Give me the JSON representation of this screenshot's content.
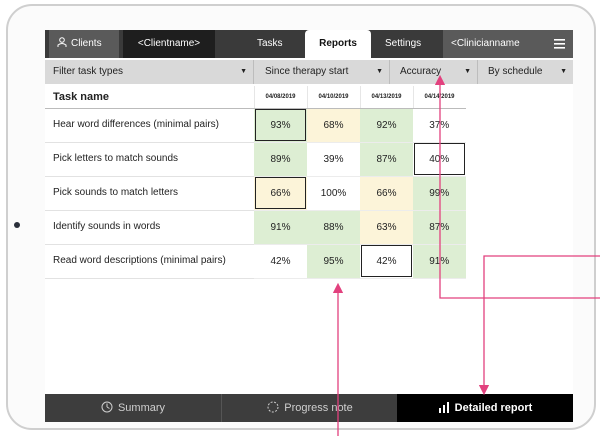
{
  "nav": {
    "clients_label": "Clients",
    "clientname": "<Clientname>",
    "tabs": [
      "Tasks",
      "Reports",
      "Settings"
    ],
    "clinician": "<Clinicianname"
  },
  "filters": {
    "task_types": "Filter task types",
    "since": "Since therapy start",
    "metric": "Accuracy",
    "schedule": "By schedule"
  },
  "table": {
    "name_header": "Task name",
    "dates": [
      "04/08/2019",
      "04/10/2019",
      "04/13/2019",
      "04/14/2019"
    ],
    "rows": [
      {
        "name": "Hear word differences (minimal pairs)",
        "values": [
          "93%",
          "68%",
          "92%",
          "37%"
        ]
      },
      {
        "name": "Pick letters to match sounds",
        "values": [
          "89%",
          "39%",
          "87%",
          "40%"
        ]
      },
      {
        "name": "Pick sounds to match letters",
        "values": [
          "66%",
          "100%",
          "66%",
          "99%"
        ]
      },
      {
        "name": "Identify sounds in words",
        "values": [
          "91%",
          "88%",
          "63%",
          "87%"
        ]
      },
      {
        "name": "Read word descriptions (minimal pairs)",
        "values": [
          "42%",
          "95%",
          "42%",
          "91%"
        ]
      }
    ]
  },
  "bottom": {
    "summary": "Summary",
    "progress": "Progress note",
    "detailed": "Detailed report"
  },
  "colors": {
    "accent": "#e2417e",
    "good": "#ddeed3",
    "mid": "#fcf4d9"
  }
}
